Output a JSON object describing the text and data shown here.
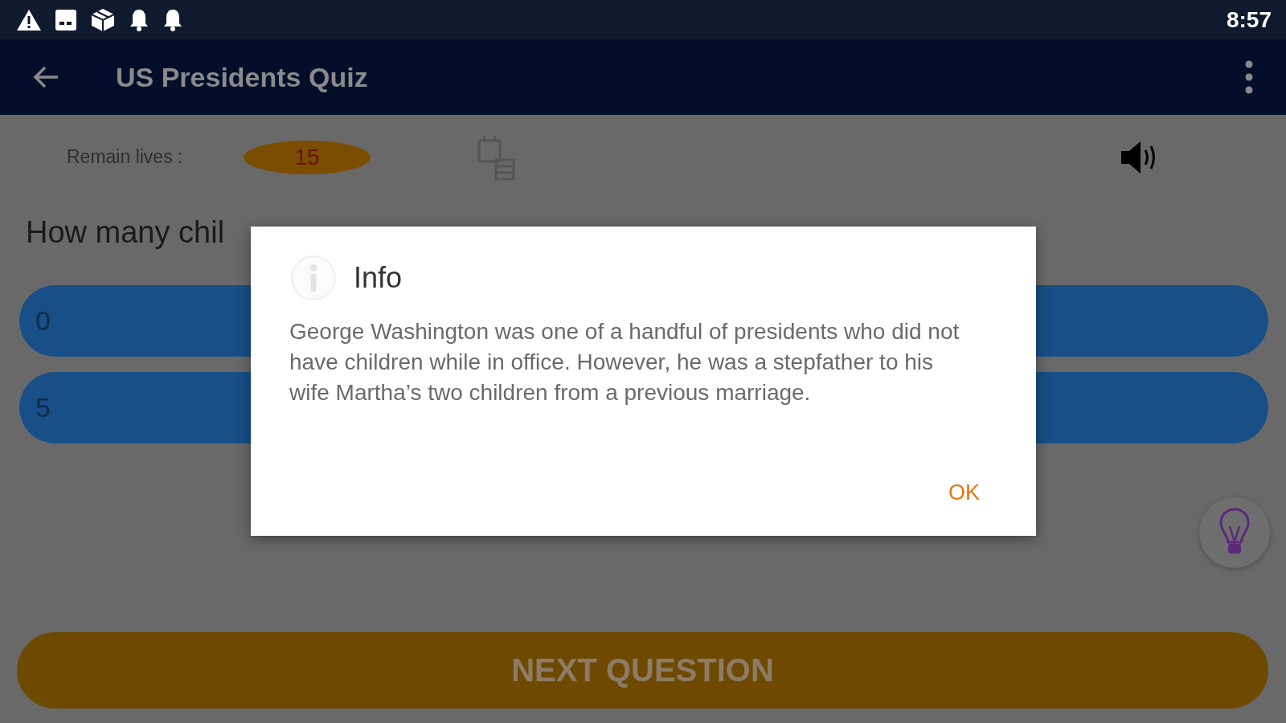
{
  "status_bar": {
    "time": "8:57"
  },
  "app_bar": {
    "title": "US Presidents Quiz"
  },
  "lives": {
    "label": "Remain lives :",
    "value": "15"
  },
  "question": "How many chil",
  "answers": [
    {
      "label": "0"
    },
    {
      "label": "5"
    }
  ],
  "next_button": "NEXT QUESTION",
  "dialog": {
    "title": "Info",
    "message": "George Washington was one of a handful of presidents who did not have children while in office. However, he was a stepfather to his wife Martha’s two children from a previous marriage.",
    "button": "OK"
  }
}
